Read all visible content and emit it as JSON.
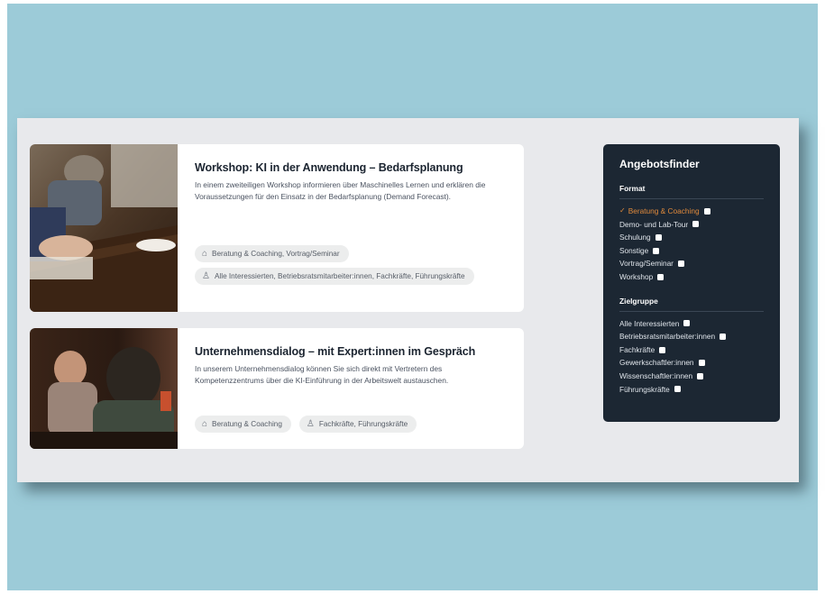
{
  "cards": [
    {
      "title": "Workshop: KI in der Anwendung – Bedarfsplanung",
      "description": "In einem zweiteiligen Workshop informieren über Maschinelles Lernen und erklären die Voraussetzungen für den Einsatz in der Bedarfsplanung (Demand Forecast).",
      "format_tag": "Beratung & Coaching, Vortrag/Seminar",
      "audience_tag": "Alle Interessierten, Betriebsratsmitarbeiter:innen, Fachkräfte, Führungskräfte",
      "format_icon": "tag-icon",
      "audience_icon": "person-icon"
    },
    {
      "title": "Unternehmensdialog – mit Expert:innen im Gespräch",
      "description": "In unserem Unternehmensdialog können Sie sich direkt mit Vertretern des Kompetenzzentrums über die KI-Einführung in der Arbeitswelt austauschen.",
      "format_tag": "Beratung & Coaching",
      "audience_tag": "Fachkräfte, Führungskräfte",
      "format_icon": "tag-icon",
      "audience_icon": "person-icon"
    }
  ],
  "finder": {
    "title": "Angebotsfinder",
    "format_label": "Format",
    "format_items": [
      "Beratung & Coaching",
      "Demo- und Lab-Tour",
      "Schulung",
      "Sonstige",
      "Vortrag/Seminar",
      "Workshop"
    ],
    "active_format": "Beratung & Coaching",
    "audience_label": "Zielgruppe",
    "audience_items": [
      "Alle Interessierten",
      "Betriebsratsmitarbeiter:innen",
      "Fachkräfte",
      "Gewerkschaftler:innen",
      "Wissenschaftler:innen",
      "Führungskräfte"
    ]
  },
  "colors": {
    "backdrop": "#9ccbd8",
    "panel": "#e8e9ec",
    "finder_bg": "#1c2733",
    "active_accent": "#e08a3c"
  }
}
